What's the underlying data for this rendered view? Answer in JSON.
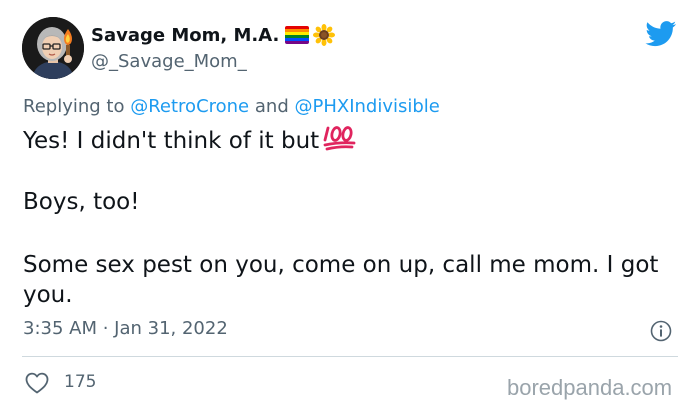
{
  "author": {
    "display_name": "Savage Mom, M.A.",
    "handle": "@_Savage_Mom_",
    "avatar": "avatar-lady-with-glasses-holding-torch",
    "name_emojis": [
      "rainbow-flag-icon",
      "sunflower-icon"
    ]
  },
  "reply": {
    "prefix": "Replying to",
    "mention_1": "@RetroCrone",
    "conjunction": "and",
    "mention_2": "@PHXIndivisible"
  },
  "body": {
    "paragraph_1": "Yes! I didn't think of it but",
    "paragraph_1_emoji": "hundred-points-icon",
    "paragraph_2": "Boys, too!",
    "paragraph_3": "Some sex pest on you, come on up, call me mom. I got you."
  },
  "meta": {
    "timestamp": "3:35 AM · Jan 31, 2022"
  },
  "engagement": {
    "like_count": "175"
  },
  "watermark": "boredpanda.com",
  "colors": {
    "text": "#0f1419",
    "secondary_text": "#536471",
    "link": "#1d9bf0",
    "twitter_blue": "#1d9bf0",
    "divider": "#cfd9de",
    "emoji_red": "#e0245e"
  }
}
